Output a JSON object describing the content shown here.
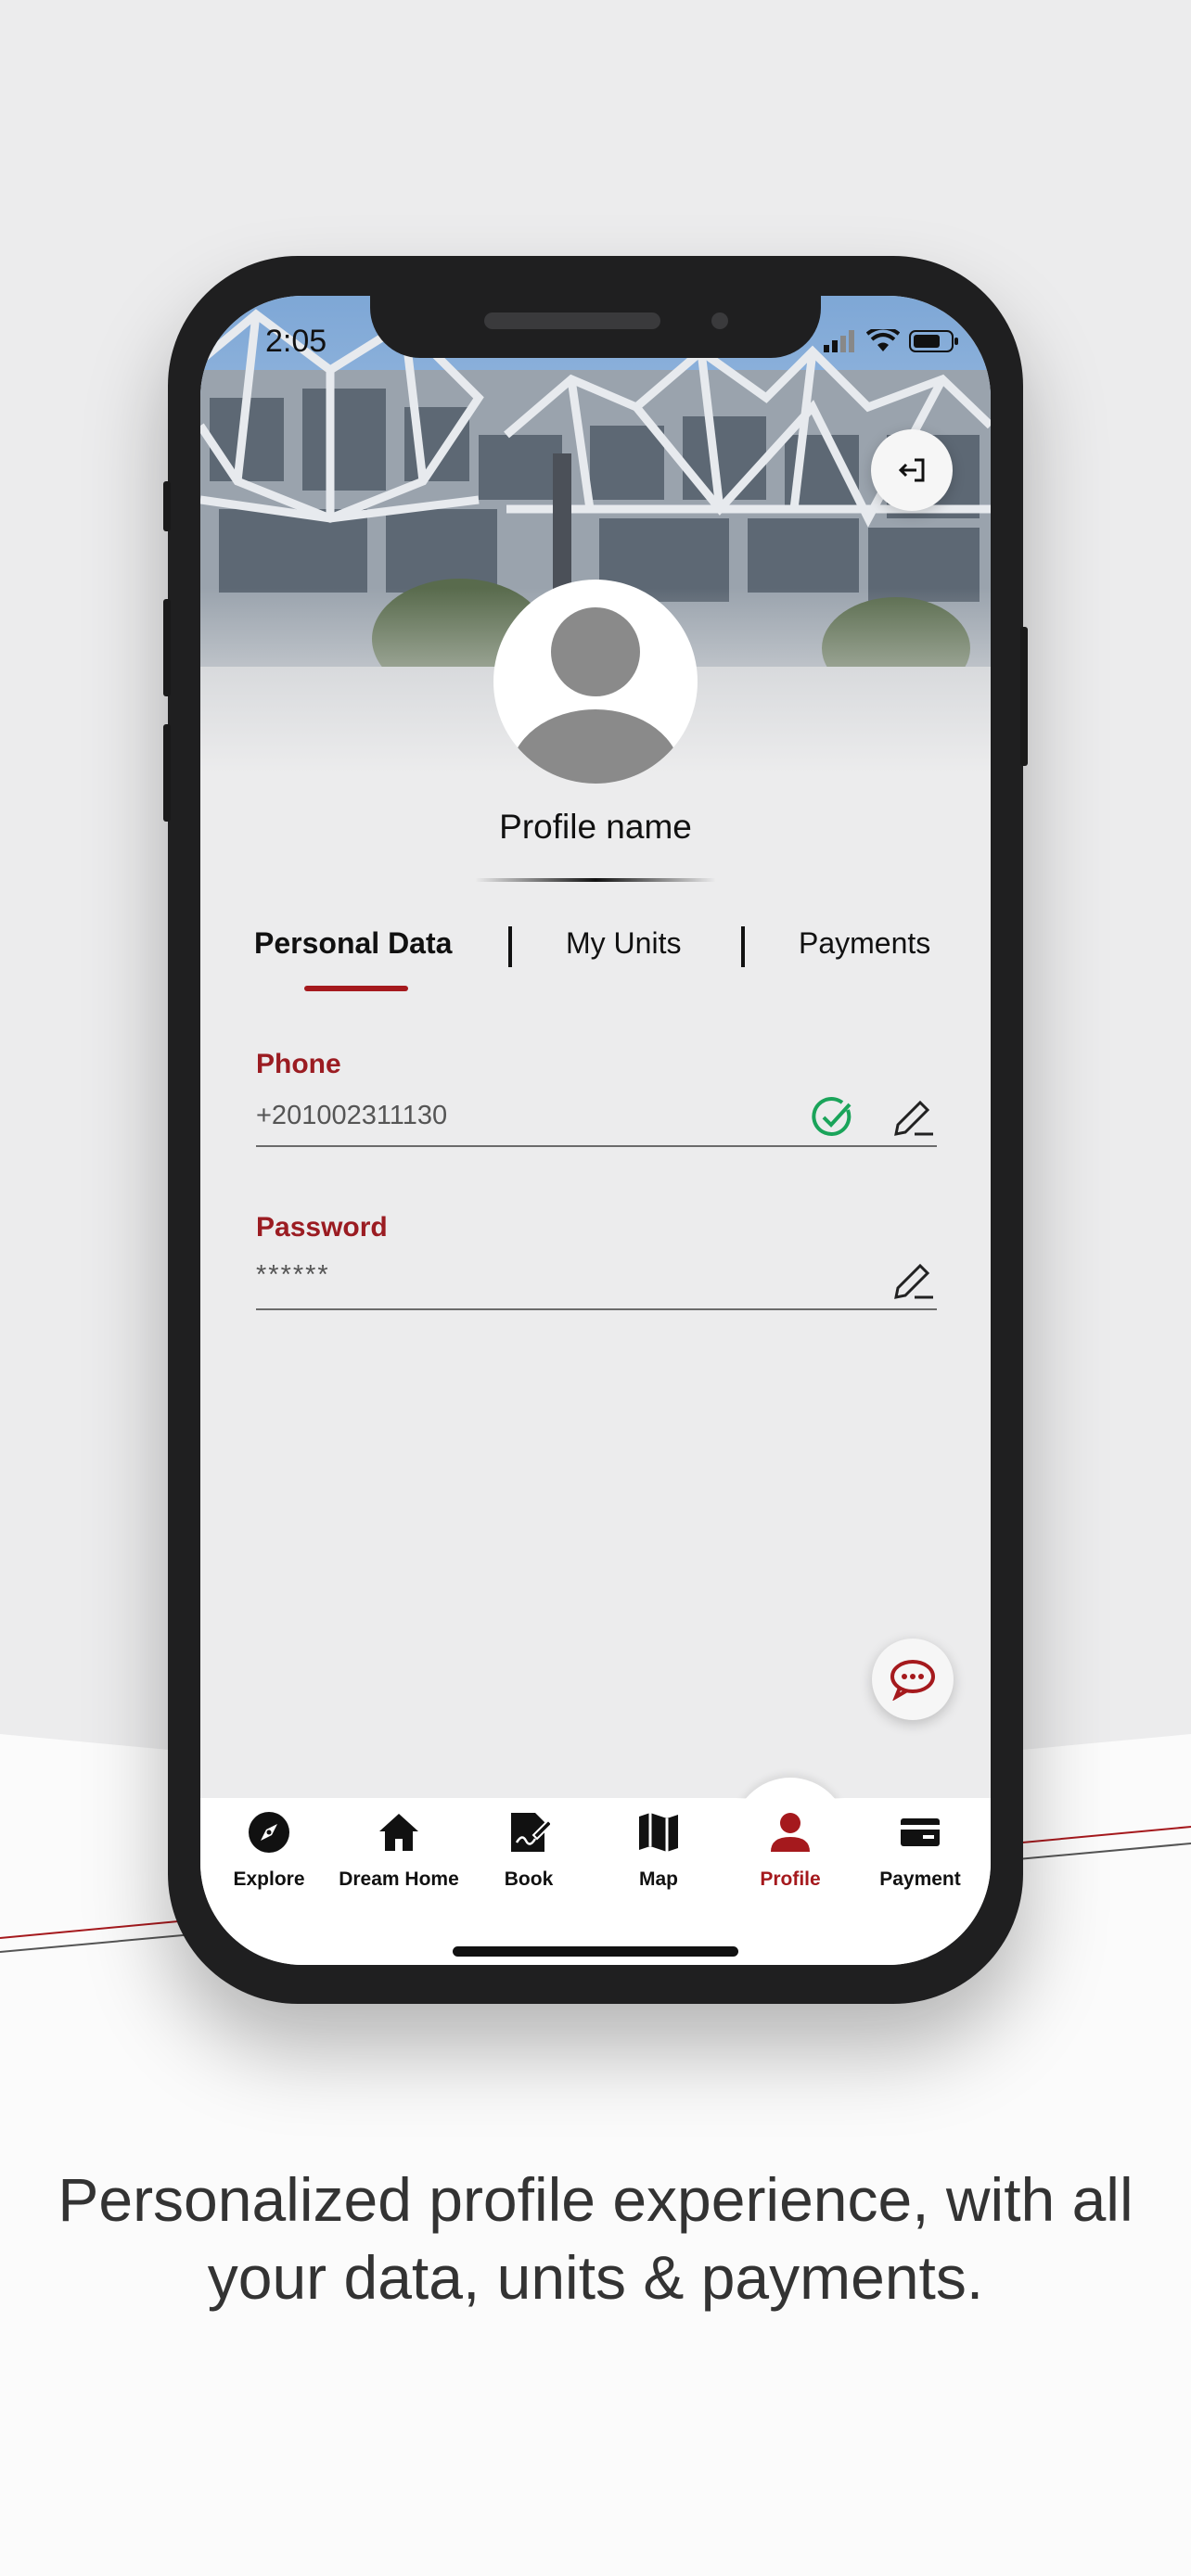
{
  "status_bar": {
    "time": "2:05"
  },
  "profile": {
    "name": "Profile name"
  },
  "tabs": [
    {
      "label": "Personal Data",
      "active": true
    },
    {
      "label": "My Units",
      "active": false
    },
    {
      "label": "Payments",
      "active": false
    }
  ],
  "fields": {
    "phone": {
      "label": "Phone",
      "value": "+201002311130",
      "verified": true
    },
    "password": {
      "label": "Password",
      "value": "******"
    }
  },
  "nav": [
    {
      "label": "Explore",
      "icon": "compass-icon"
    },
    {
      "label": "Dream Home",
      "icon": "home-icon"
    },
    {
      "label": "Book",
      "icon": "book-sign-icon"
    },
    {
      "label": "Map",
      "icon": "map-icon"
    },
    {
      "label": "Profile",
      "icon": "person-icon",
      "active": true
    },
    {
      "label": "Payment",
      "icon": "card-icon"
    }
  ],
  "caption": "Personalized profile experience, with all your data, units & payments.",
  "colors": {
    "accent": "#a5191d",
    "verified": "#1aa45a",
    "background": "#ececed"
  }
}
